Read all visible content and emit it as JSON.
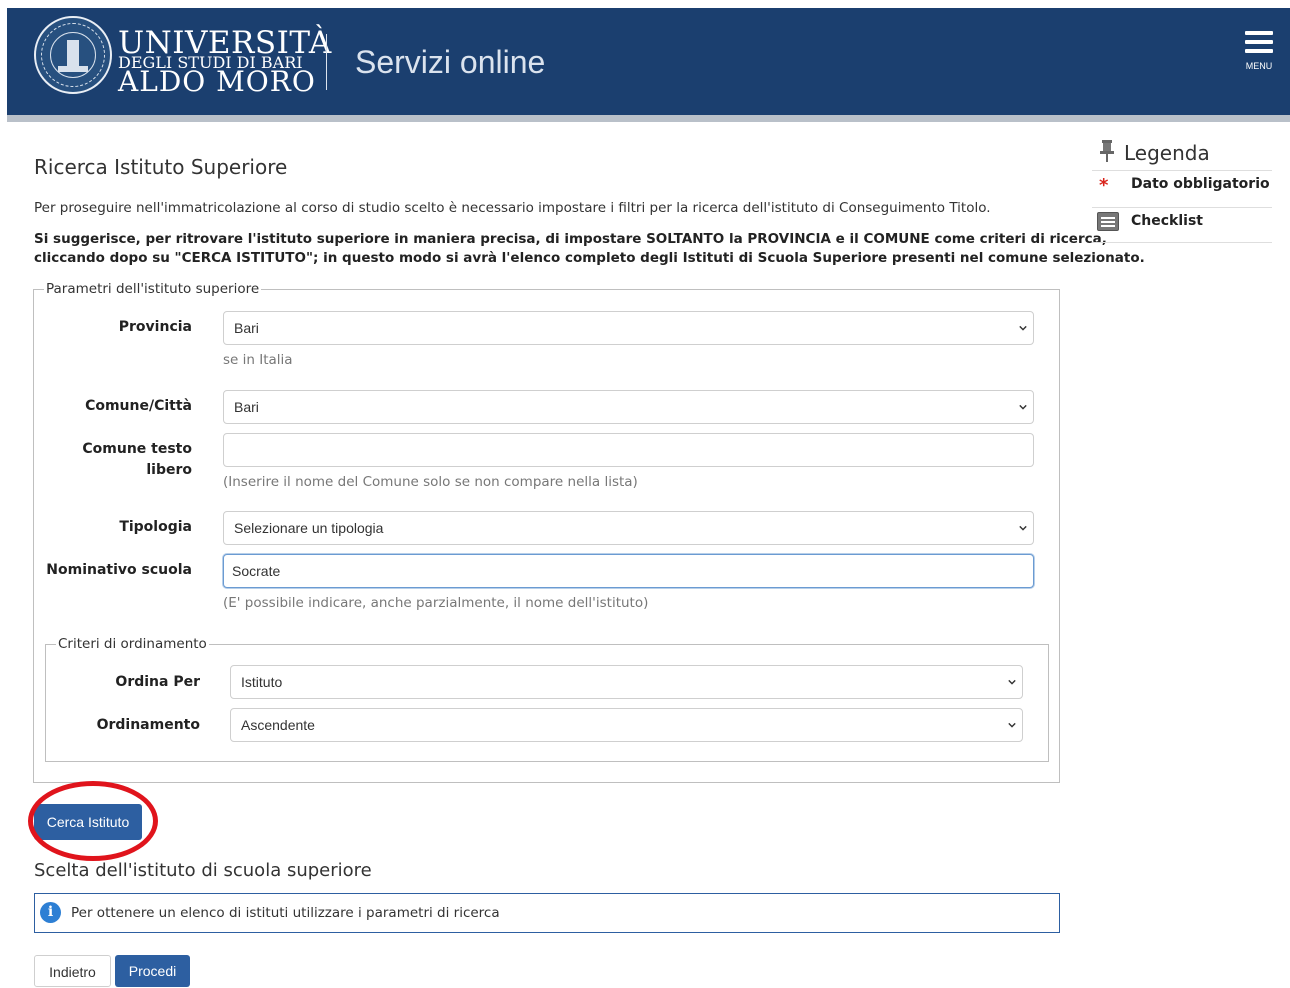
{
  "header": {
    "university_line1": "UNIVERSITÀ",
    "university_line2": "DEGLI STUDI DI BARI",
    "university_line3": "ALDO MORO",
    "title": "Servizi online",
    "menu_label": "MENU",
    "bg_color": "#1b3f6f"
  },
  "main": {
    "page_title": "Ricerca Istituto Superiore",
    "intro": "Per proseguire nell'immatricolazione al corso di studio scelto è necessario impostare i filtri per la ricerca dell'istituto di Conseguimento Titolo.",
    "note_line1": "Si suggerisce, per ritrovare l'istituto superiore in maniera precisa, di impostare SOLTANTO la PROVINCIA e il COMUNE come criteri di ricerca,",
    "note_line2": "cliccando dopo su \"CERCA ISTITUTO\"; in questo modo si avrà l'elenco completo degli Istituti di Scuola Superiore presenti nel comune selezionato."
  },
  "params": {
    "legend": "Parametri dell'istituto superiore",
    "provincia_label": "Provincia",
    "provincia_value": "Bari",
    "provincia_hint": "se in Italia",
    "comune_label": "Comune/Città",
    "comune_value": "Bari",
    "comune_libero_label_1": "Comune testo",
    "comune_libero_label_2": "libero",
    "comune_libero_value": "",
    "comune_libero_hint": "(Inserire il nome del Comune solo se non compare nella lista)",
    "tipologia_label": "Tipologia",
    "tipologia_value": "Selezionare un tipologia",
    "nominativo_label": "Nominativo scuola",
    "nominativo_value": "Socrate",
    "nominativo_hint": "(E' possibile indicare, anche parzialmente, il nome dell'istituto)"
  },
  "ordering": {
    "legend": "Criteri di ordinamento",
    "ordina_per_label": "Ordina Per",
    "ordina_per_value": "Istituto",
    "ordinamento_label": "Ordinamento",
    "ordinamento_value": "Ascendente"
  },
  "actions": {
    "cerca_label": "Cerca Istituto",
    "indietro_label": "Indietro",
    "procedi_label": "Procedi"
  },
  "results": {
    "title": "Scelta dell'istituto di scuola superiore",
    "info": "Per ottenere un elenco di istituti utilizzare i parametri di ricerca"
  },
  "legenda": {
    "title": "Legenda",
    "required": "Dato obbligatorio",
    "checklist": "Checklist",
    "required_color": "#d9251d"
  },
  "annotation": {
    "highlight_color": "#e0141c"
  }
}
